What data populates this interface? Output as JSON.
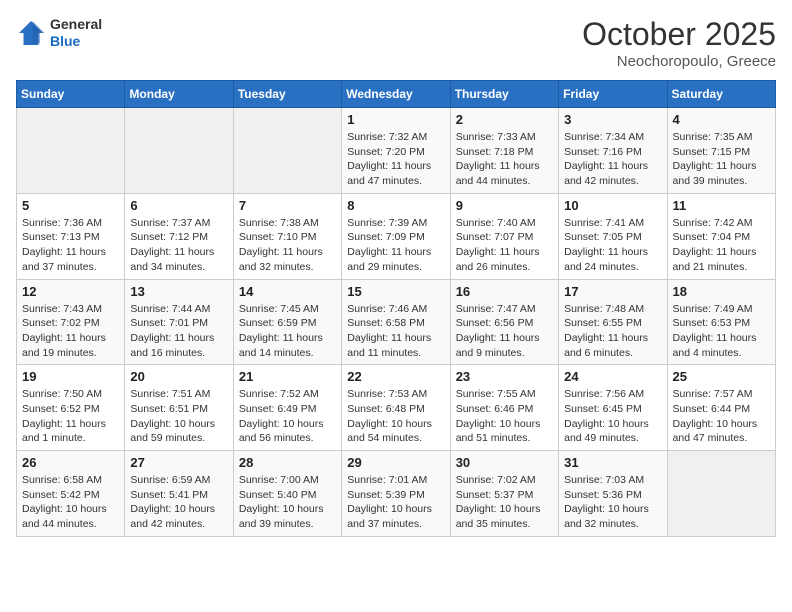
{
  "logo": {
    "general": "General",
    "blue": "Blue"
  },
  "header": {
    "month": "October 2025",
    "location": "Neochoropoulo, Greece"
  },
  "weekdays": [
    "Sunday",
    "Monday",
    "Tuesday",
    "Wednesday",
    "Thursday",
    "Friday",
    "Saturday"
  ],
  "weeks": [
    [
      {
        "day": "",
        "info": ""
      },
      {
        "day": "",
        "info": ""
      },
      {
        "day": "",
        "info": ""
      },
      {
        "day": "1",
        "info": "Sunrise: 7:32 AM\nSunset: 7:20 PM\nDaylight: 11 hours and 47 minutes."
      },
      {
        "day": "2",
        "info": "Sunrise: 7:33 AM\nSunset: 7:18 PM\nDaylight: 11 hours and 44 minutes."
      },
      {
        "day": "3",
        "info": "Sunrise: 7:34 AM\nSunset: 7:16 PM\nDaylight: 11 hours and 42 minutes."
      },
      {
        "day": "4",
        "info": "Sunrise: 7:35 AM\nSunset: 7:15 PM\nDaylight: 11 hours and 39 minutes."
      }
    ],
    [
      {
        "day": "5",
        "info": "Sunrise: 7:36 AM\nSunset: 7:13 PM\nDaylight: 11 hours and 37 minutes."
      },
      {
        "day": "6",
        "info": "Sunrise: 7:37 AM\nSunset: 7:12 PM\nDaylight: 11 hours and 34 minutes."
      },
      {
        "day": "7",
        "info": "Sunrise: 7:38 AM\nSunset: 7:10 PM\nDaylight: 11 hours and 32 minutes."
      },
      {
        "day": "8",
        "info": "Sunrise: 7:39 AM\nSunset: 7:09 PM\nDaylight: 11 hours and 29 minutes."
      },
      {
        "day": "9",
        "info": "Sunrise: 7:40 AM\nSunset: 7:07 PM\nDaylight: 11 hours and 26 minutes."
      },
      {
        "day": "10",
        "info": "Sunrise: 7:41 AM\nSunset: 7:05 PM\nDaylight: 11 hours and 24 minutes."
      },
      {
        "day": "11",
        "info": "Sunrise: 7:42 AM\nSunset: 7:04 PM\nDaylight: 11 hours and 21 minutes."
      }
    ],
    [
      {
        "day": "12",
        "info": "Sunrise: 7:43 AM\nSunset: 7:02 PM\nDaylight: 11 hours and 19 minutes."
      },
      {
        "day": "13",
        "info": "Sunrise: 7:44 AM\nSunset: 7:01 PM\nDaylight: 11 hours and 16 minutes."
      },
      {
        "day": "14",
        "info": "Sunrise: 7:45 AM\nSunset: 6:59 PM\nDaylight: 11 hours and 14 minutes."
      },
      {
        "day": "15",
        "info": "Sunrise: 7:46 AM\nSunset: 6:58 PM\nDaylight: 11 hours and 11 minutes."
      },
      {
        "day": "16",
        "info": "Sunrise: 7:47 AM\nSunset: 6:56 PM\nDaylight: 11 hours and 9 minutes."
      },
      {
        "day": "17",
        "info": "Sunrise: 7:48 AM\nSunset: 6:55 PM\nDaylight: 11 hours and 6 minutes."
      },
      {
        "day": "18",
        "info": "Sunrise: 7:49 AM\nSunset: 6:53 PM\nDaylight: 11 hours and 4 minutes."
      }
    ],
    [
      {
        "day": "19",
        "info": "Sunrise: 7:50 AM\nSunset: 6:52 PM\nDaylight: 11 hours and 1 minute."
      },
      {
        "day": "20",
        "info": "Sunrise: 7:51 AM\nSunset: 6:51 PM\nDaylight: 10 hours and 59 minutes."
      },
      {
        "day": "21",
        "info": "Sunrise: 7:52 AM\nSunset: 6:49 PM\nDaylight: 10 hours and 56 minutes."
      },
      {
        "day": "22",
        "info": "Sunrise: 7:53 AM\nSunset: 6:48 PM\nDaylight: 10 hours and 54 minutes."
      },
      {
        "day": "23",
        "info": "Sunrise: 7:55 AM\nSunset: 6:46 PM\nDaylight: 10 hours and 51 minutes."
      },
      {
        "day": "24",
        "info": "Sunrise: 7:56 AM\nSunset: 6:45 PM\nDaylight: 10 hours and 49 minutes."
      },
      {
        "day": "25",
        "info": "Sunrise: 7:57 AM\nSunset: 6:44 PM\nDaylight: 10 hours and 47 minutes."
      }
    ],
    [
      {
        "day": "26",
        "info": "Sunrise: 6:58 AM\nSunset: 5:42 PM\nDaylight: 10 hours and 44 minutes."
      },
      {
        "day": "27",
        "info": "Sunrise: 6:59 AM\nSunset: 5:41 PM\nDaylight: 10 hours and 42 minutes."
      },
      {
        "day": "28",
        "info": "Sunrise: 7:00 AM\nSunset: 5:40 PM\nDaylight: 10 hours and 39 minutes."
      },
      {
        "day": "29",
        "info": "Sunrise: 7:01 AM\nSunset: 5:39 PM\nDaylight: 10 hours and 37 minutes."
      },
      {
        "day": "30",
        "info": "Sunrise: 7:02 AM\nSunset: 5:37 PM\nDaylight: 10 hours and 35 minutes."
      },
      {
        "day": "31",
        "info": "Sunrise: 7:03 AM\nSunset: 5:36 PM\nDaylight: 10 hours and 32 minutes."
      },
      {
        "day": "",
        "info": ""
      }
    ]
  ]
}
